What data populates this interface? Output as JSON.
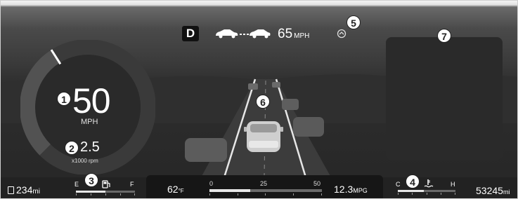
{
  "top": {
    "gear": "D",
    "set_speed": "65",
    "set_speed_unit": "MPH"
  },
  "speedometer": {
    "speed": "50",
    "speed_unit": "MPH",
    "rpm": "2.5",
    "rpm_unit": "x1000 rpm",
    "needle_fraction": 0.38
  },
  "bottom": {
    "range_value": "234",
    "range_unit": "mi",
    "fuel_empty": "E",
    "fuel_full": "F",
    "fuel_fraction": 0.5,
    "outside_temp": "62",
    "outside_temp_unit": "°F",
    "mpg_scale": [
      "0",
      "25",
      "50"
    ],
    "mpg_fraction": 0.36,
    "mpg_value": "12.3",
    "mpg_unit": "MPG",
    "coolant_cold": "C",
    "coolant_hot": "H",
    "coolant_fraction": 0.45,
    "odometer_value": "53245",
    "odometer_unit": "mi"
  },
  "callouts": [
    "1",
    "2",
    "3",
    "4",
    "5",
    "6",
    "7"
  ],
  "icons": [
    "fuel-pump-icon",
    "coolant-temp-icon",
    "adaptive-cruise-icon",
    "lead-vehicle-icon",
    "own-vehicle-icon"
  ]
}
